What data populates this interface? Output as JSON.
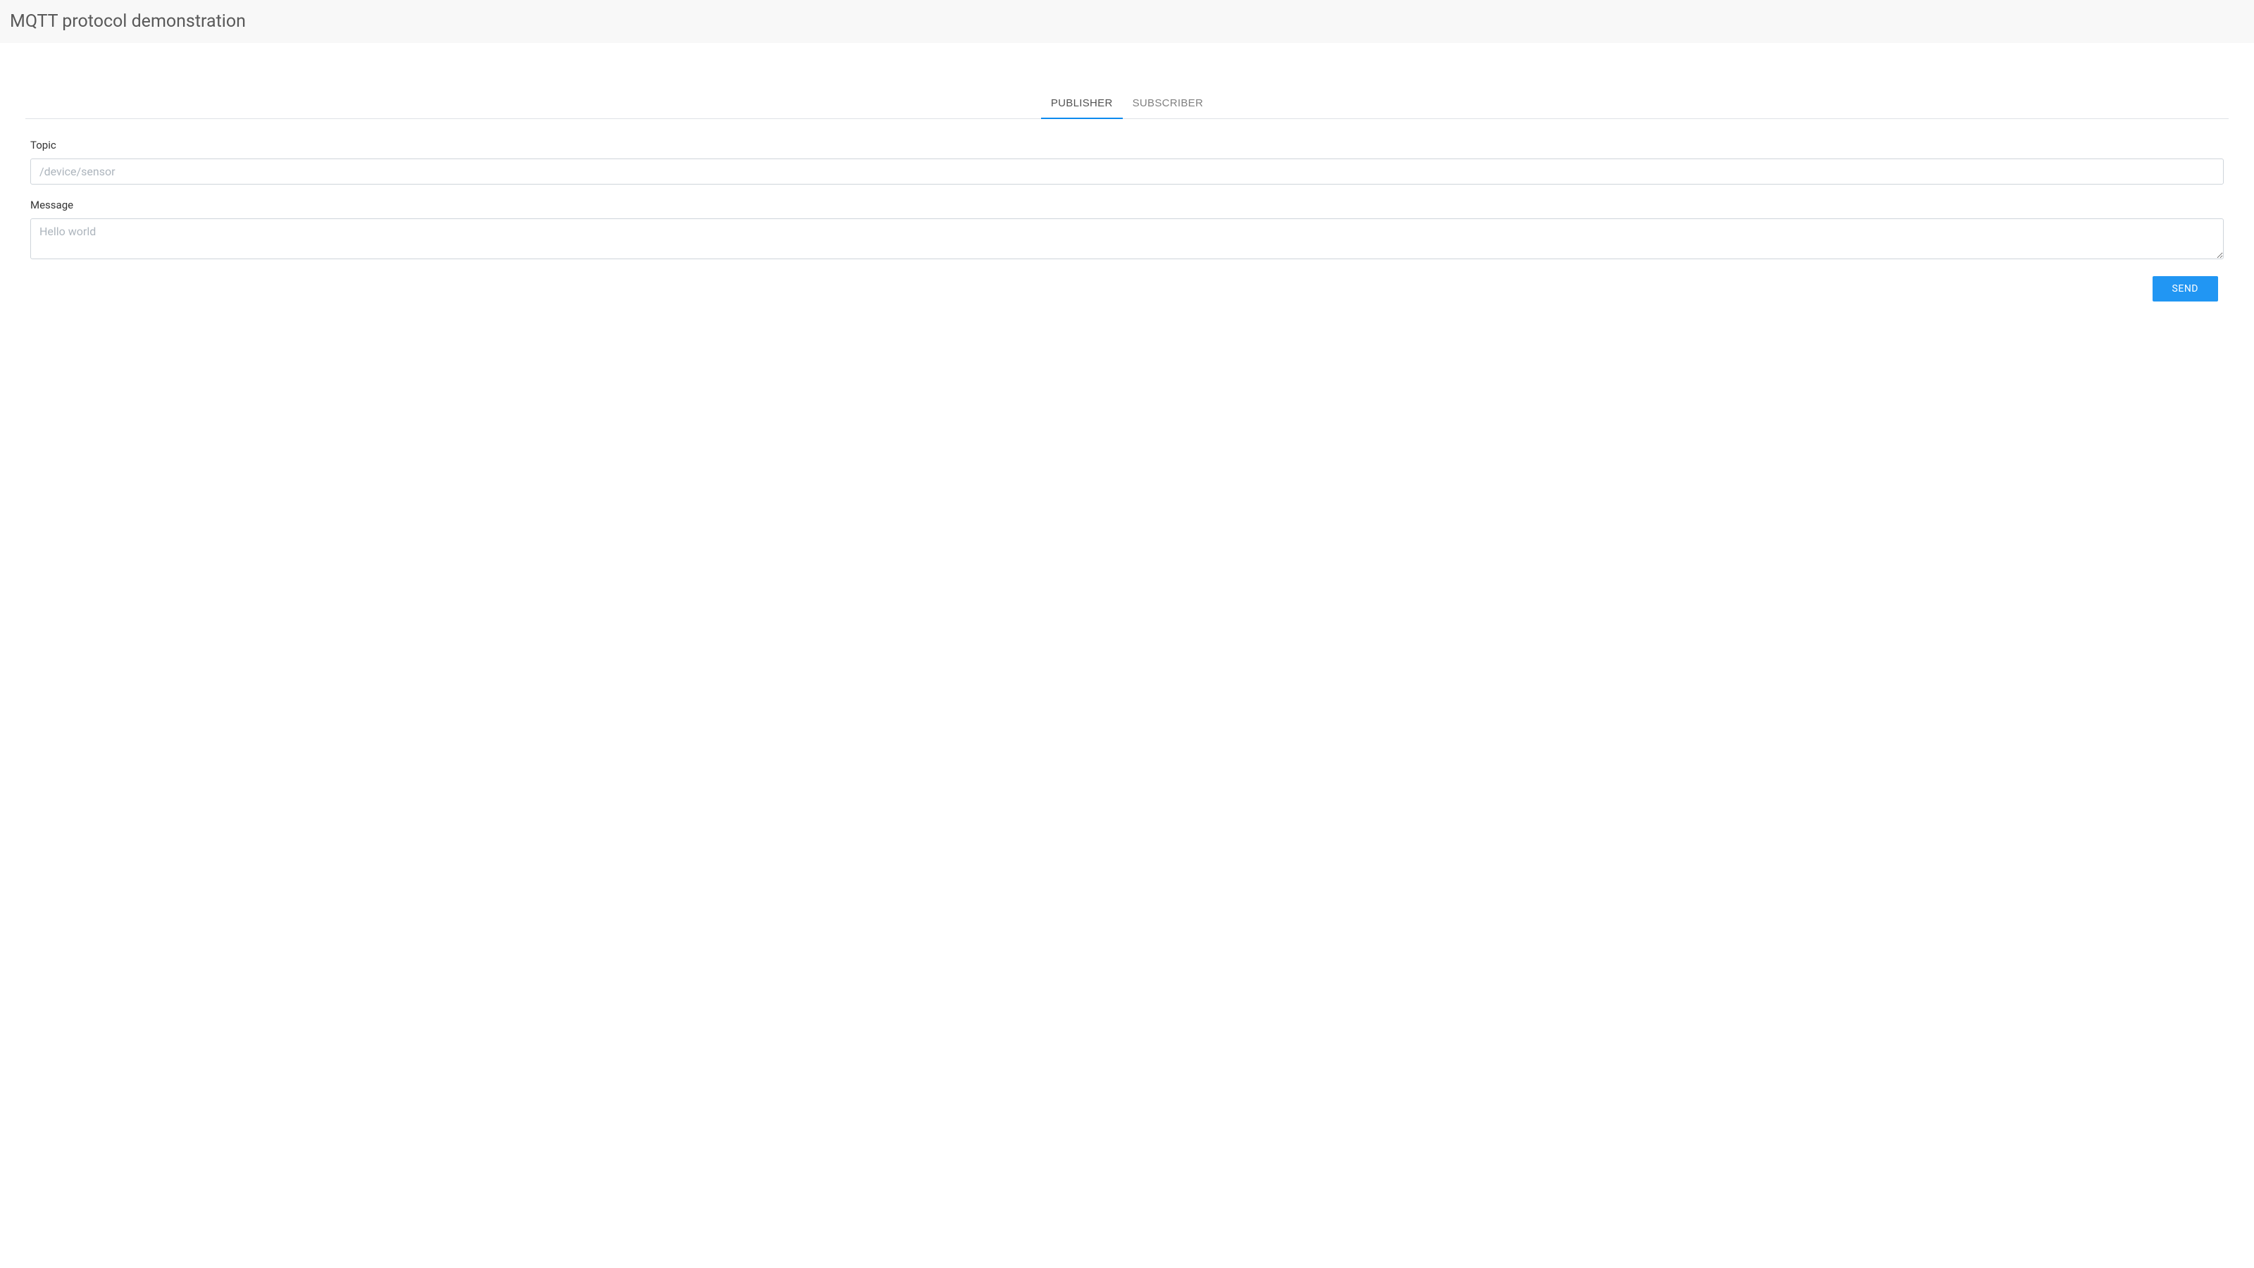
{
  "header": {
    "title": "MQTT protocol demonstration"
  },
  "tabs": {
    "publisher": "PUBLISHER",
    "subscriber": "SUBSCRIBER"
  },
  "form": {
    "topic": {
      "label": "Topic",
      "placeholder": "/device/sensor",
      "value": ""
    },
    "message": {
      "label": "Message",
      "placeholder": "Hello world",
      "value": ""
    },
    "send_button": "SEND"
  }
}
